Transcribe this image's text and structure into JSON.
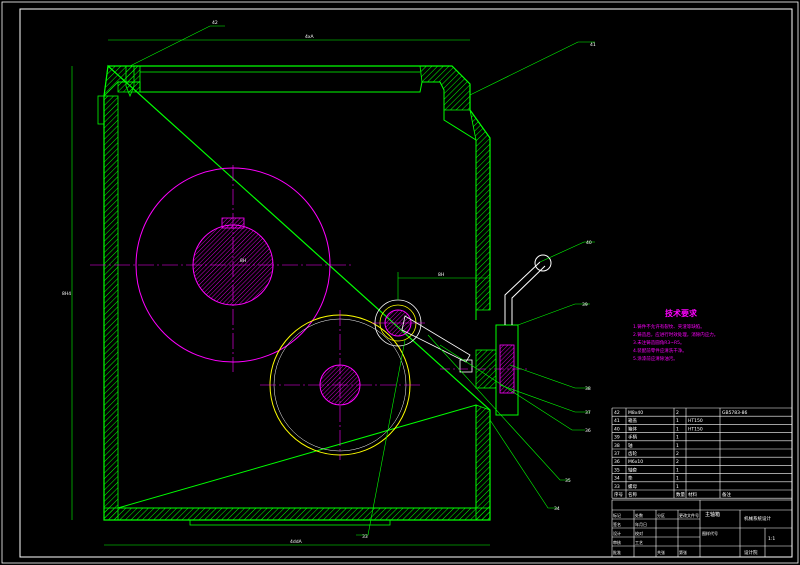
{
  "labels": {
    "n42": "42",
    "n41": "41",
    "n40": "40",
    "n39": "39",
    "n38": "38",
    "n37": "37",
    "n36": "36",
    "n35": "35",
    "n34": "34",
    "n33": "33",
    "top_dim": "4xA",
    "small_dim": "8H",
    "left_dim": "8H4",
    "bottom_dim": "4ddA",
    "gear_mark": "8H"
  },
  "tech": {
    "title": "技术要求",
    "lines": [
      "1.铸件不允许有裂纹、夹渣等缺陷。",
      "2.铸造后，应进行时效处理，消除内应力。",
      "3.未注铸造圆角R3~R5。",
      "4.装配前零件应清洗干净。",
      "5.涂漆前应清除油污。"
    ]
  },
  "bom": [
    {
      "no": "42",
      "name": "M8x40",
      "qty": "2",
      "mat": "",
      "note": "GB5783-86"
    },
    {
      "no": "41",
      "name": "箱盖",
      "qty": "1",
      "mat": "HT150",
      "note": ""
    },
    {
      "no": "40",
      "name": "箱体",
      "qty": "1",
      "mat": "HT150",
      "note": ""
    },
    {
      "no": "39",
      "name": "手柄",
      "qty": "1",
      "mat": "",
      "note": ""
    },
    {
      "no": "38",
      "name": "轴",
      "qty": "1",
      "mat": "",
      "note": ""
    },
    {
      "no": "37",
      "name": "齿轮",
      "qty": "2",
      "mat": "",
      "note": ""
    },
    {
      "no": "36",
      "name": "M6x10",
      "qty": "2",
      "mat": "",
      "note": ""
    },
    {
      "no": "35",
      "name": "轴套",
      "qty": "1",
      "mat": "",
      "note": ""
    },
    {
      "no": "34",
      "name": "垫",
      "qty": "1",
      "mat": "",
      "note": ""
    },
    {
      "no": "33",
      "name": "螺母",
      "qty": "1",
      "mat": "",
      "note": ""
    }
  ],
  "bom_header": {
    "no": "序号",
    "name": "名称",
    "qty": "数量",
    "mat": "材料",
    "note": "备注"
  },
  "title_block": {
    "part": "主轴箱",
    "drawing_name": "机械系统设计",
    "dept": "设计院",
    "scale": "1:1",
    "cells": [
      "标记",
      "处数",
      "分区",
      "更改文件号",
      "签名",
      "年月日",
      "设计",
      "校对",
      "审核",
      "工艺",
      "批准",
      "共张",
      "第张",
      "图样代号"
    ]
  },
  "colors": {
    "frame": "#ffffff",
    "outline": "#00ff00",
    "gear": "#ff00ff",
    "yellow": "#ffff00",
    "hatch": "#ff00ff",
    "text": "#ffffff"
  }
}
